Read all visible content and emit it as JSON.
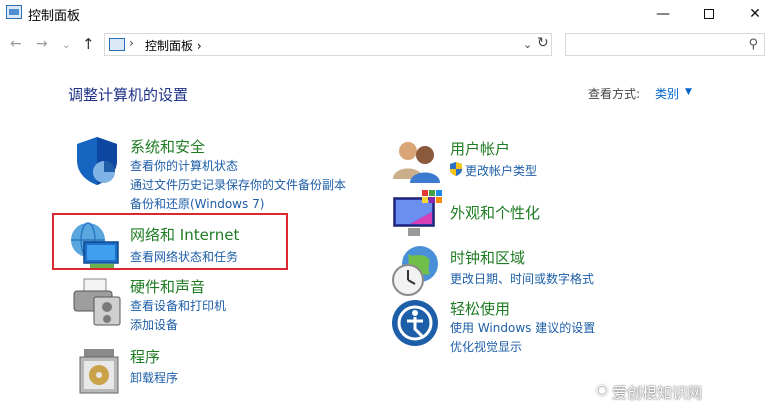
{
  "window": {
    "title": "控制面板",
    "minimize_glyph": "—",
    "close_glyph": "✕"
  },
  "nav": {
    "back_glyph": "←",
    "forward_glyph": "→",
    "recent_glyph": "⌄",
    "up_glyph": "↑",
    "address": {
      "separator": "›",
      "path": "控制面板",
      "path_separator": "›",
      "dropdown_glyph": "⌄",
      "refresh_glyph": "↻"
    },
    "search": {
      "placeholder": "",
      "icon_glyph": "⚲"
    }
  },
  "main": {
    "heading": "调整计算机的设置",
    "view_by": {
      "label": "查看方式:",
      "value": "类别",
      "caret": "▼"
    }
  },
  "categories": {
    "left": [
      {
        "title": "系统和安全",
        "links": [
          "查看你的计算机状态",
          "通过文件历史记录保存你的文件备份副本",
          "备份和还原(Windows 7)"
        ]
      },
      {
        "title": "网络和 Internet",
        "links": [
          "查看网络状态和任务"
        ]
      },
      {
        "title": "硬件和声音",
        "links": [
          "查看设备和打印机",
          "添加设备"
        ]
      },
      {
        "title": "程序",
        "links": [
          "卸载程序"
        ]
      }
    ],
    "right": [
      {
        "title": "用户帐户",
        "links": [
          "更改帐户类型"
        ]
      },
      {
        "title": "外观和个性化",
        "links": []
      },
      {
        "title": "时钟和区域",
        "links": [
          "更改日期、时间或数字格式"
        ]
      },
      {
        "title": "轻松使用",
        "links": [
          "使用 Windows 建议的设置",
          "优化视觉显示"
        ]
      }
    ]
  },
  "watermark": {
    "text": "爱创根知识网"
  },
  "colors": {
    "title_green": "#1e7c23",
    "link_blue": "#1d5ea8",
    "heading_blue": "#1e3287",
    "highlight_red": "#d9282e"
  }
}
